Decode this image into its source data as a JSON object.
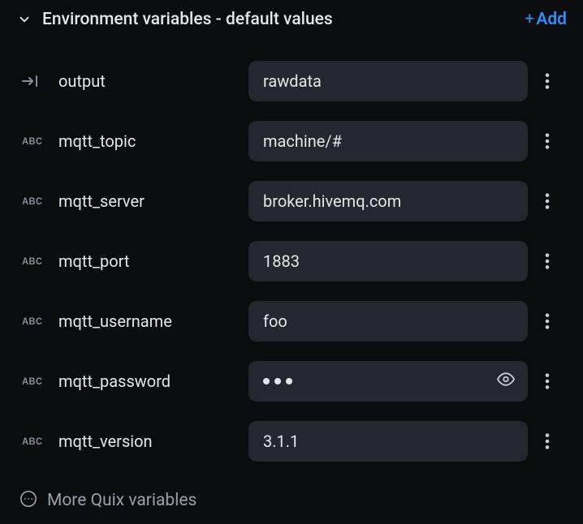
{
  "header": {
    "title": "Environment variables - default values",
    "add_label": "Add"
  },
  "variables": [
    {
      "type": "output",
      "name": "output",
      "value": "rawdata",
      "is_password": false
    },
    {
      "type": "abc",
      "name": "mqtt_topic",
      "value": "machine/#",
      "is_password": false
    },
    {
      "type": "abc",
      "name": "mqtt_server",
      "value": "broker.hivemq.com",
      "is_password": false
    },
    {
      "type": "abc",
      "name": "mqtt_port",
      "value": "1883",
      "is_password": false
    },
    {
      "type": "abc",
      "name": "mqtt_username",
      "value": "foo",
      "is_password": false
    },
    {
      "type": "abc",
      "name": "mqtt_password",
      "value": "•••",
      "is_password": true
    },
    {
      "type": "abc",
      "name": "mqtt_version",
      "value": "3.1.1",
      "is_password": false
    }
  ],
  "footer": {
    "more_label": "More Quix variables"
  }
}
